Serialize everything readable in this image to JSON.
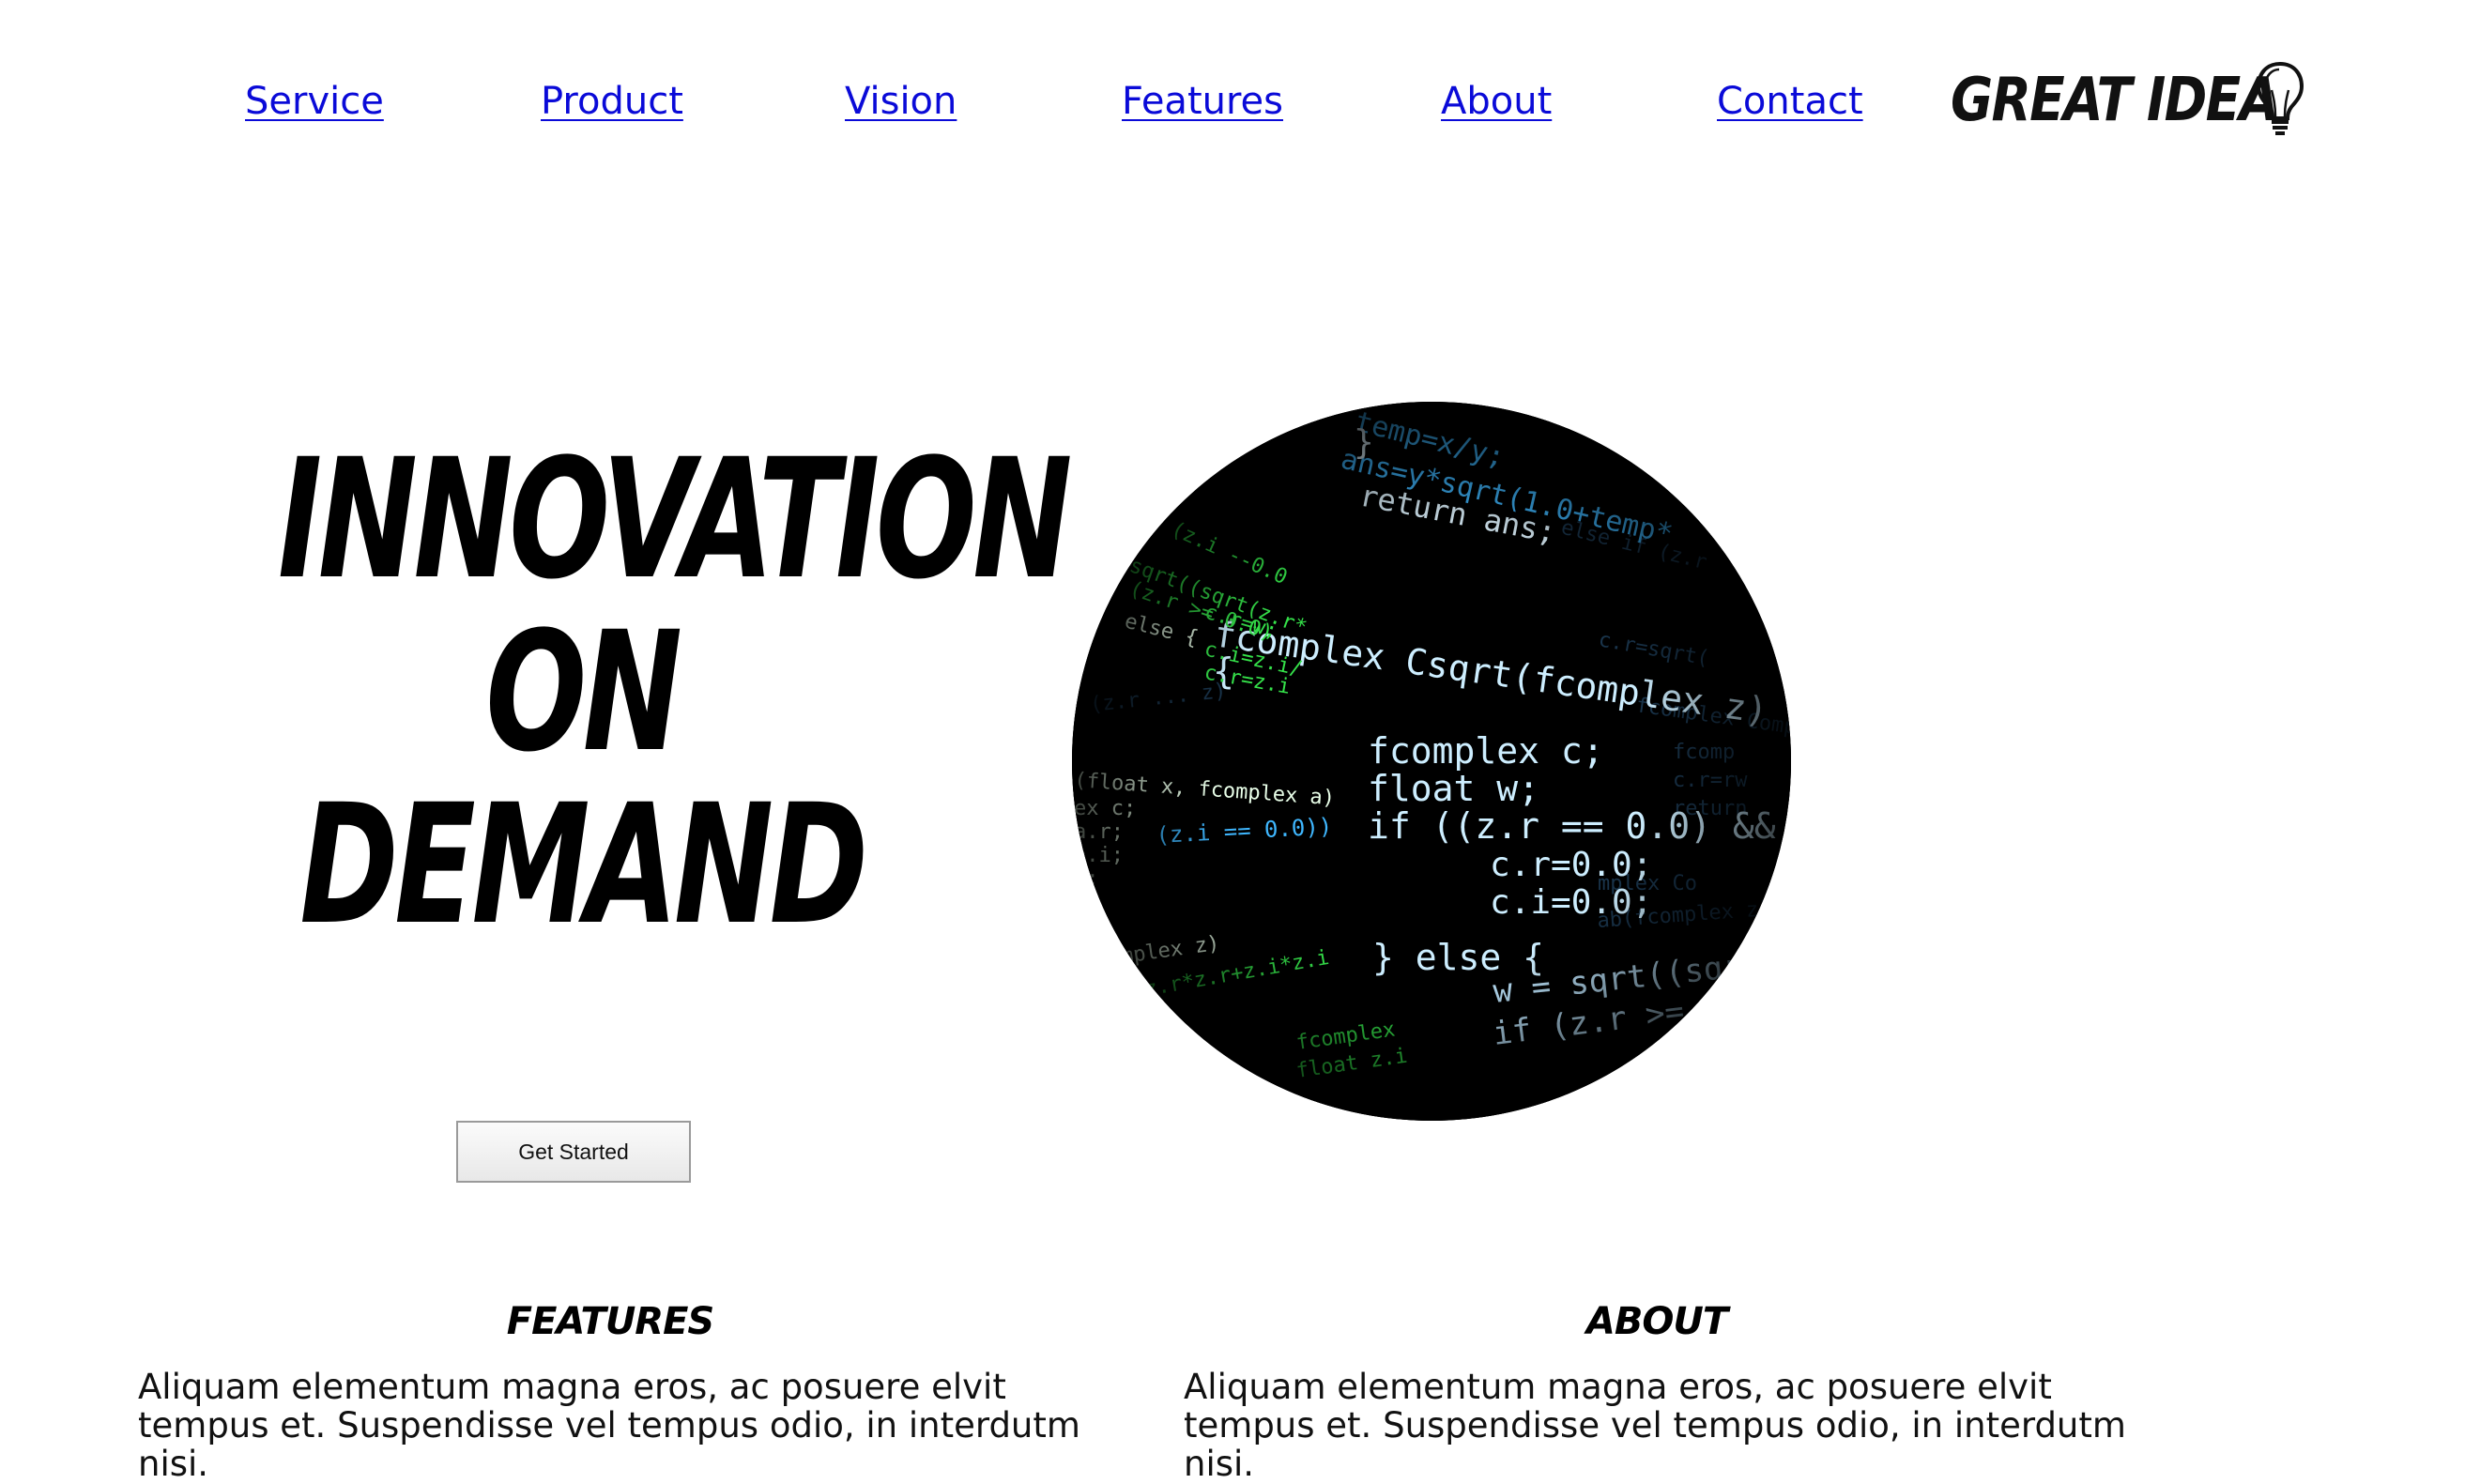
{
  "nav": {
    "links": [
      "Service",
      "Product",
      "Vision",
      "Features",
      "About",
      "Contact"
    ]
  },
  "logo": {
    "text": "GREAT IDEA",
    "icon": "lightbulb-icon"
  },
  "hero": {
    "title_lines": [
      "INNOVATION",
      "ON",
      "DEMAND"
    ],
    "button_label": "Get Started",
    "image_alt": "code-screen-image"
  },
  "sections": [
    {
      "heading": "FEATURES",
      "body": "Aliquam elementum magna eros, ac posuere elvit tempus et. Suspendisse vel tempus odio, in interdutm nisi."
    },
    {
      "heading": "ABOUT",
      "body": "Aliquam elementum magna eros, ac posuere elvit tempus et. Suspendisse vel tempus odio, in interdutm nisi."
    }
  ],
  "colors": {
    "link": "#0a0ad8",
    "text": "#000000",
    "code_blue": "#3fb7ff",
    "code_green": "#35e24a",
    "code_bg": "#000000"
  }
}
